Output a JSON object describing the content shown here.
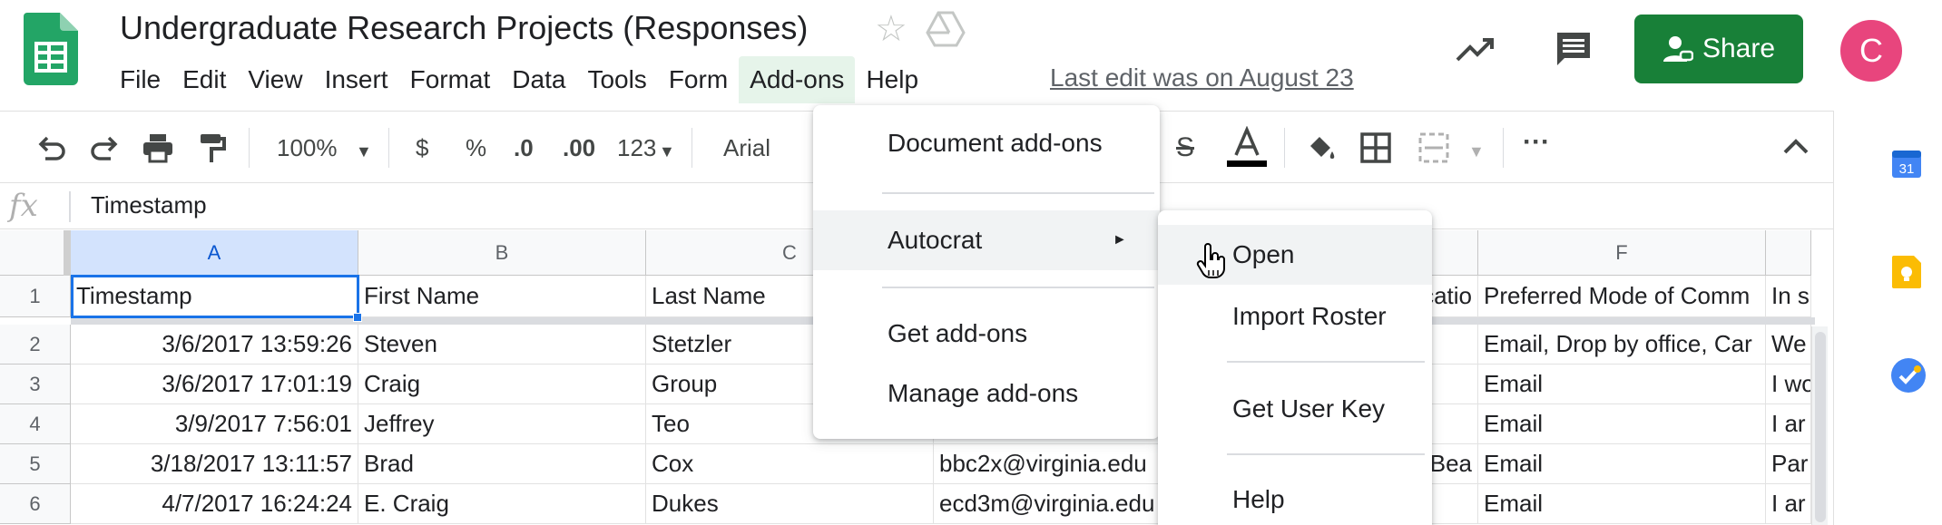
{
  "header": {
    "title": "Undergraduate Research Projects (Responses)",
    "last_edit": "Last edit was on August 23",
    "share_label": "Share",
    "avatar_letter": "C"
  },
  "menubar": [
    "File",
    "Edit",
    "View",
    "Insert",
    "Format",
    "Data",
    "Tools",
    "Form",
    "Add-ons",
    "Help"
  ],
  "active_menu": "Add-ons",
  "toolbar": {
    "zoom": "100%",
    "currency": "$",
    "percent": "%",
    "decrease_decimal": ".0",
    "increase_decimal": ".00",
    "more_formats": "123",
    "font": "Arial"
  },
  "formula_bar": {
    "fx": "fx",
    "value": "Timestamp"
  },
  "grid": {
    "columns": [
      "A",
      "B",
      "C",
      "F"
    ],
    "rows": [
      {
        "num": "1",
        "cells": [
          "Timestamp",
          "First Name",
          "Last Name",
          "",
          "catio",
          "Preferred Mode of Comm",
          "In s"
        ]
      },
      {
        "num": "2",
        "cells": [
          "3/6/2017 13:59:26",
          "Steven",
          "Stetzler",
          "",
          "",
          "Email, Drop by office, Car",
          "We"
        ]
      },
      {
        "num": "3",
        "cells": [
          "3/6/2017 17:01:19",
          "Craig",
          "Group",
          "",
          "",
          "Email",
          "I wo"
        ]
      },
      {
        "num": "4",
        "cells": [
          "3/9/2017 7:56:01",
          "Jeffrey",
          "Teo",
          "",
          "",
          "Email",
          "I ar"
        ]
      },
      {
        "num": "5",
        "cells": [
          "3/18/2017 13:11:57",
          "Brad",
          "Cox",
          "bbc2x@virginia.edu",
          "Bea",
          "Email",
          "Par"
        ]
      },
      {
        "num": "6",
        "cells": [
          "4/7/2017 16:24:24",
          "E. Craig",
          "Dukes",
          "ecd3m@virginia.edu",
          "",
          "Email",
          "I ar"
        ]
      }
    ]
  },
  "addons_menu": {
    "document_addons": "Document add-ons",
    "autocrat": "Autocrat",
    "arrow": "►",
    "get_addons": "Get add-ons",
    "manage_addons": "Manage add-ons"
  },
  "autocrat_menu": {
    "open": "Open",
    "import_roster": "Import Roster",
    "get_user_key": "Get User Key",
    "help": "Help"
  },
  "side_panel": {
    "calendar_day": "31"
  },
  "colors": {
    "brand_green": "#188038",
    "selection_blue": "#1a73e8",
    "avatar_pink": "#e8457d"
  }
}
